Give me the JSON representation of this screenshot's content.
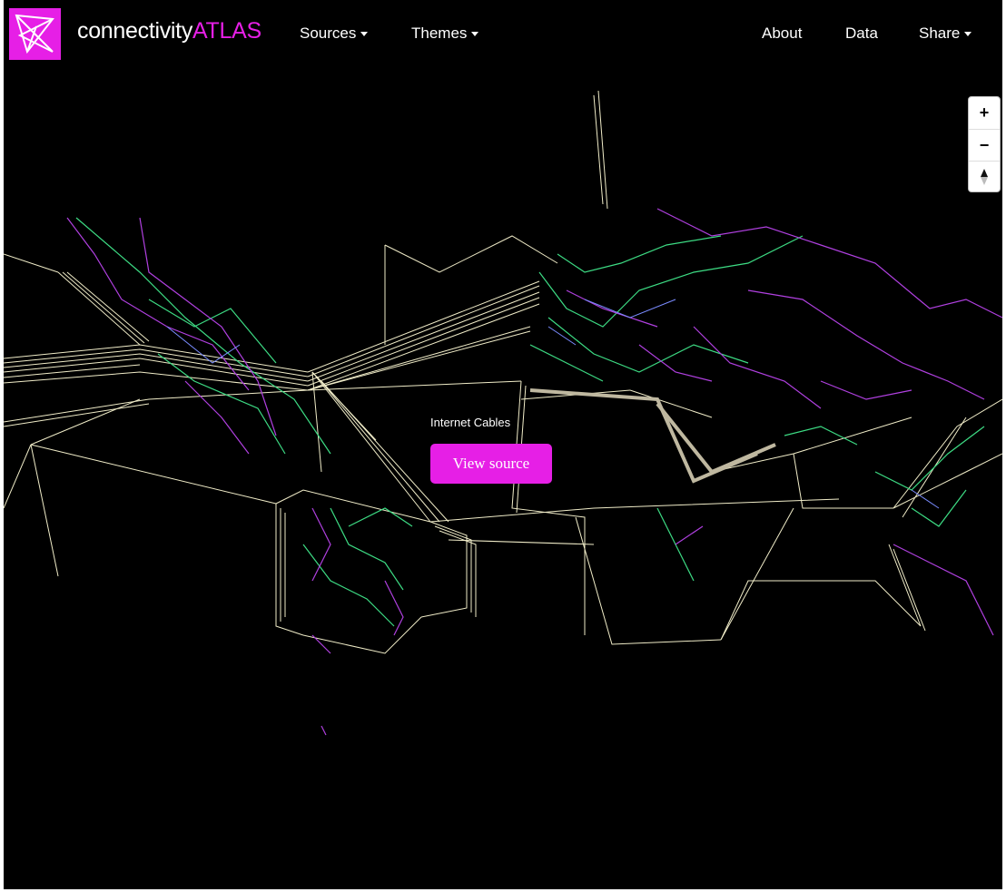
{
  "brand": {
    "name_part1": "connectivity",
    "name_part2": "ATLAS"
  },
  "nav": {
    "sources_label": "Sources",
    "themes_label": "Themes",
    "about_label": "About",
    "data_label": "Data",
    "share_label": "Share"
  },
  "zoom": {
    "in_label": "+",
    "out_label": "−"
  },
  "popup": {
    "title": "Internet Cables",
    "button_label": "View source"
  },
  "colors": {
    "accent": "#e61fe6",
    "cable": "#f0ecc8",
    "green": "#3ddc84",
    "purple": "#b040e0",
    "blue": "#7a8cff"
  },
  "icons": {
    "logo": "connectivity-logo-icon",
    "north": "compass-north-icon"
  }
}
